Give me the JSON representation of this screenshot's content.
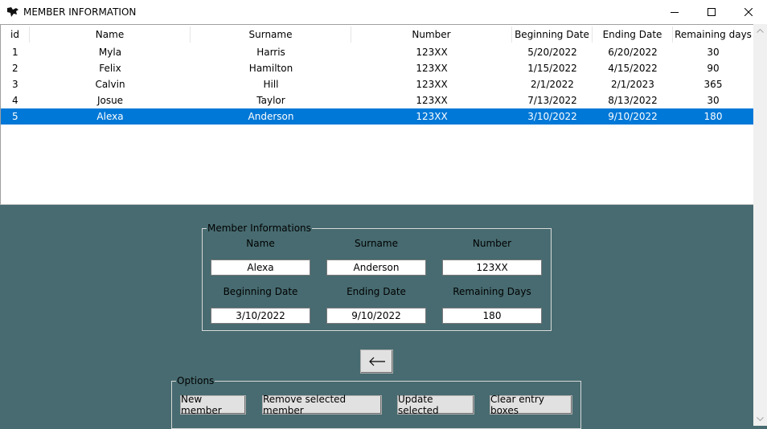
{
  "window": {
    "title": "MEMBER INFORMATION"
  },
  "table": {
    "columns": [
      "id",
      "Name",
      "Surname",
      "Number",
      "Beginning Date",
      "Ending Date",
      "Remaining days"
    ],
    "rows": [
      [
        "1",
        "Myla",
        "Harris",
        "123XX",
        "5/20/2022",
        "6/20/2022",
        "30"
      ],
      [
        "2",
        "Felix",
        "Hamilton",
        "123XX",
        "1/15/2022",
        "4/15/2022",
        "90"
      ],
      [
        "3",
        "Calvin",
        "Hill",
        "123XX",
        "2/1/2022",
        "2/1/2023",
        "365"
      ],
      [
        "4",
        "Josue",
        "Taylor",
        "123XX",
        "7/13/2022",
        "8/13/2022",
        "30"
      ],
      [
        "5",
        "Alexa",
        "Anderson",
        "123XX",
        "3/10/2022",
        "9/10/2022",
        "180"
      ]
    ],
    "selected_row": 4
  },
  "member_form": {
    "group_label": "Member Informations",
    "name_label": "Name",
    "surname_label": "Surname",
    "number_label": "Number",
    "beginning_label": "Beginning Date",
    "ending_label": "Ending Date",
    "remaining_label": "Remaining Days",
    "name_value": "Alexa",
    "surname_value": "Anderson",
    "number_value": "123XX",
    "beginning_value": "3/10/2022",
    "ending_value": "9/10/2022",
    "remaining_value": "180"
  },
  "back_button": {
    "icon": "arrow-left-icon"
  },
  "options": {
    "group_label": "Options",
    "new_member": "New member",
    "remove_selected": "Remove selected member",
    "update_selected": "Update selected",
    "clear_entries": "Clear entry boxes"
  },
  "colors": {
    "background": "#476b70",
    "selection": "#0078d7"
  }
}
